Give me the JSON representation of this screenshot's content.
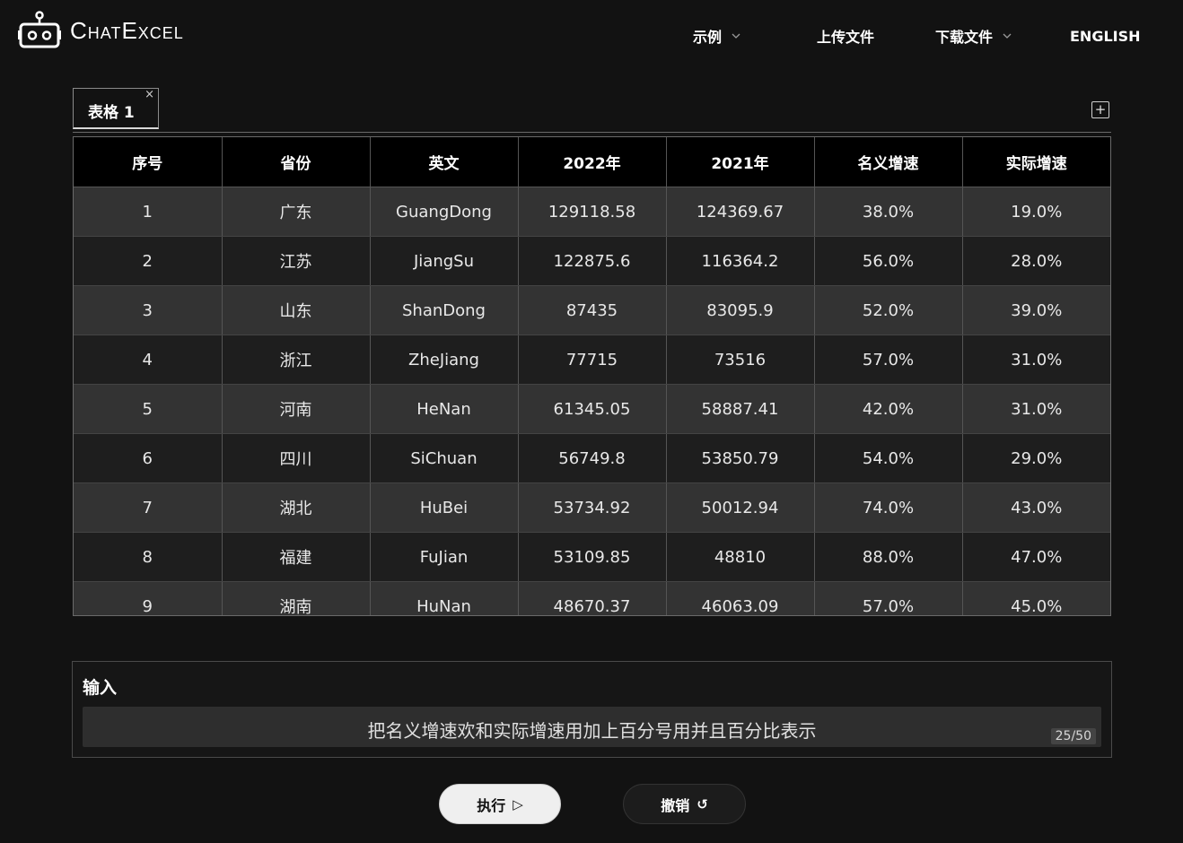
{
  "header": {
    "logo_text": "ChatExcel",
    "nav": [
      {
        "label": "示例",
        "has_dropdown": true
      },
      {
        "label": "上传文件",
        "has_dropdown": false
      },
      {
        "label": "下载文件",
        "has_dropdown": true
      },
      {
        "label": "ENGLISH",
        "has_dropdown": false
      }
    ]
  },
  "tabs": [
    {
      "label": "表格 1",
      "active": true,
      "close_glyph": "×"
    }
  ],
  "add_tab_glyph": "+",
  "table": {
    "columns": [
      "序号",
      "省份",
      "英文",
      "2022年",
      "2021年",
      "名义增速",
      "实际增速"
    ],
    "rows": [
      [
        "1",
        "广东",
        "GuangDong",
        "129118.58",
        "124369.67",
        "38.0%",
        "19.0%"
      ],
      [
        "2",
        "江苏",
        "JiangSu",
        "122875.6",
        "116364.2",
        "56.0%",
        "28.0%"
      ],
      [
        "3",
        "山东",
        "ShanDong",
        "87435",
        "83095.9",
        "52.0%",
        "39.0%"
      ],
      [
        "4",
        "浙江",
        "ZheJiang",
        "77715",
        "73516",
        "57.0%",
        "31.0%"
      ],
      [
        "5",
        "河南",
        "HeNan",
        "61345.05",
        "58887.41",
        "42.0%",
        "31.0%"
      ],
      [
        "6",
        "四川",
        "SiChuan",
        "56749.8",
        "53850.79",
        "54.0%",
        "29.0%"
      ],
      [
        "7",
        "湖北",
        "HuBei",
        "53734.92",
        "50012.94",
        "74.0%",
        "43.0%"
      ],
      [
        "8",
        "福建",
        "FuJian",
        "53109.85",
        "48810",
        "88.0%",
        "47.0%"
      ],
      [
        "9",
        "湖南",
        "HuNan",
        "48670.37",
        "46063.09",
        "57.0%",
        "45.0%"
      ]
    ]
  },
  "input": {
    "title": "输入",
    "value": "把名义增速欢和实际增速用加上百分号用并且百分比表示",
    "counter": "25/50"
  },
  "buttons": {
    "run_label": "执行",
    "run_icon": "▷",
    "undo_label": "撤销",
    "undo_icon": "↺"
  }
}
